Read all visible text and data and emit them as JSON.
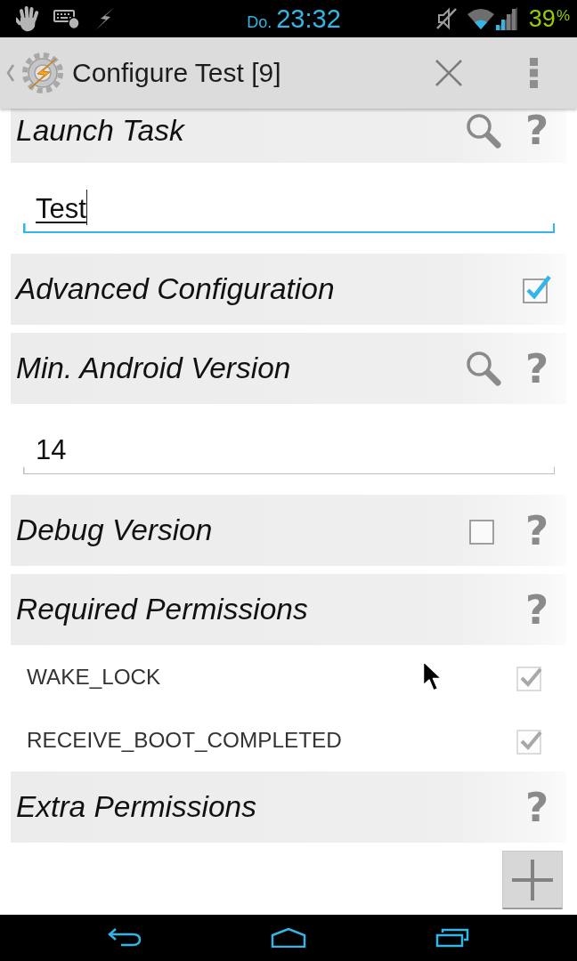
{
  "status_bar": {
    "day": "Do.",
    "time": "23:32",
    "battery": "39",
    "battery_unit": "%"
  },
  "action_bar": {
    "title": "Configure Test [9]"
  },
  "rows": [
    {
      "kind": "header",
      "label": "Launch Task",
      "actions": [
        {
          "kind": "search"
        },
        {
          "kind": "help",
          "glyph": "?"
        }
      ]
    },
    {
      "kind": "field",
      "value": "Test",
      "focused": true
    },
    {
      "kind": "header",
      "label": "Advanced Configuration",
      "actions": [
        {
          "kind": "checkbox",
          "checked": true
        }
      ]
    },
    {
      "kind": "header",
      "label": "Min. Android Version",
      "actions": [
        {
          "kind": "search"
        },
        {
          "kind": "help",
          "glyph": "?"
        }
      ]
    },
    {
      "kind": "field",
      "value": "14",
      "focused": false
    },
    {
      "kind": "header",
      "label": "Debug Version",
      "actions": [
        {
          "kind": "checkbox",
          "checked": false
        },
        {
          "kind": "help",
          "glyph": "?"
        }
      ]
    },
    {
      "kind": "header",
      "label": "Required Permissions",
      "actions": [
        {
          "kind": "help",
          "glyph": "?"
        }
      ]
    },
    {
      "kind": "permission",
      "label": "WAKE_LOCK",
      "checked": true,
      "disabled": true
    },
    {
      "kind": "permission",
      "label": "RECEIVE_BOOT_COMPLETED",
      "checked": true,
      "disabled": true
    },
    {
      "kind": "header",
      "label": "Extra Permissions",
      "actions": [
        {
          "kind": "help",
          "glyph": "?"
        }
      ]
    }
  ]
}
